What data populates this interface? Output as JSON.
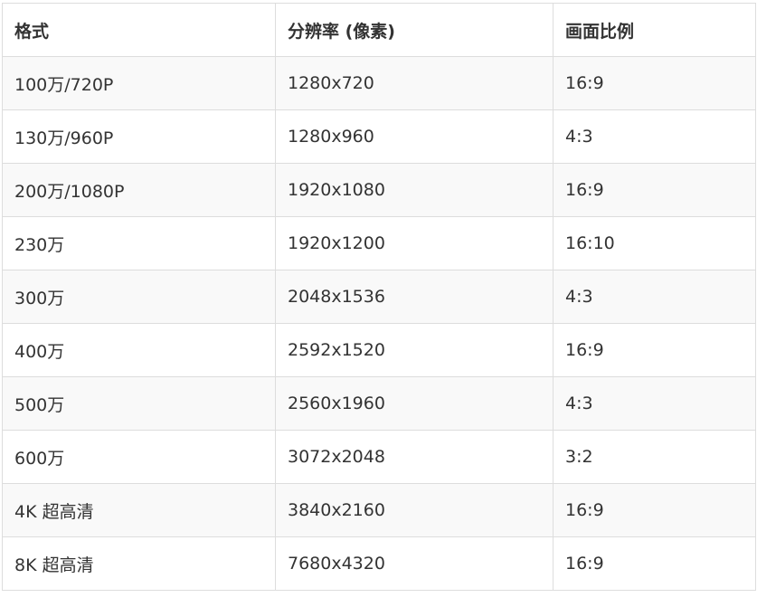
{
  "table": {
    "headers": [
      "格式",
      "分辨率 (像素)",
      "画面比例"
    ],
    "rows": [
      [
        "100万/720P",
        "1280x720",
        "16:9"
      ],
      [
        "130万/960P",
        "1280x960",
        "4:3"
      ],
      [
        "200万/1080P",
        "1920x1080",
        "16:9"
      ],
      [
        "230万",
        "1920x1200",
        "16:10"
      ],
      [
        "300万",
        "2048x1536",
        "4:3"
      ],
      [
        "400万",
        "2592x1520",
        "16:9"
      ],
      [
        "500万",
        "2560x1960",
        "4:3"
      ],
      [
        "600万",
        "3072x2048",
        "3:2"
      ],
      [
        "4K 超高清",
        "3840x2160",
        "16:9"
      ],
      [
        "8K 超高清",
        "7680x4320",
        "16:9"
      ]
    ]
  }
}
